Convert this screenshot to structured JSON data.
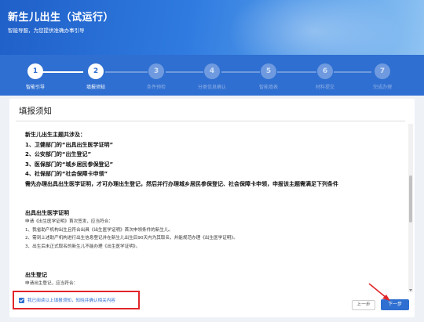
{
  "banner": {
    "title": "新生儿出生（试运行）",
    "subtitle": "智能导服，为您提供准确办事引导"
  },
  "steps": [
    {
      "num": "1",
      "label": "智能引导",
      "state": "active"
    },
    {
      "num": "2",
      "label": "填报须知",
      "state": "active"
    },
    {
      "num": "3",
      "label": "条件预检",
      "state": "inactive"
    },
    {
      "num": "4",
      "label": "分类信息确认",
      "state": "inactive"
    },
    {
      "num": "5",
      "label": "智能填表",
      "state": "inactive"
    },
    {
      "num": "6",
      "label": "材料提交",
      "state": "inactive"
    },
    {
      "num": "7",
      "label": "完成办理",
      "state": "inactive"
    }
  ],
  "panel": {
    "title": "填报须知",
    "intro": [
      "新生儿出生主题共涉及：",
      "1、卫健部门的“出具出生医学证明”",
      "2、公安部门的“出生登记”",
      "3、医保部门的“城乡居民参保登记”",
      "4、社保部门的“社会保障卡申领”",
      "需先办理出具出生医学证明，才可办理出生登记，然后并行办理城乡居民参保登记、社会保障卡申领，申报该主题需满足下列条件"
    ],
    "section1": {
      "heading": "出具出生医学证明",
      "lines": [
        "申请《出生医学证明》首次签发，应当符合：",
        "1、我省助产机构出生且符合出具《出生医学证明》首次申领条件的新生儿。",
        "2、需到上述助产机构进行出生信息登记并在新生儿出生后90天内为其取名，并能规范办理《出生医学证明》。",
        "3、出生后未正式取名的新生儿不能办理《出生医学证明》。"
      ]
    },
    "section2": {
      "heading": "出生登记",
      "lines": [
        "申请出生登记，应当符合："
      ]
    },
    "confirm_text": "我已阅读以上填报须知，知晓并确认相关内容",
    "prev_label": "上一步",
    "next_label": "下一步"
  },
  "colors": {
    "accent": "#2f6fd1",
    "highlight": "#e0262a"
  }
}
